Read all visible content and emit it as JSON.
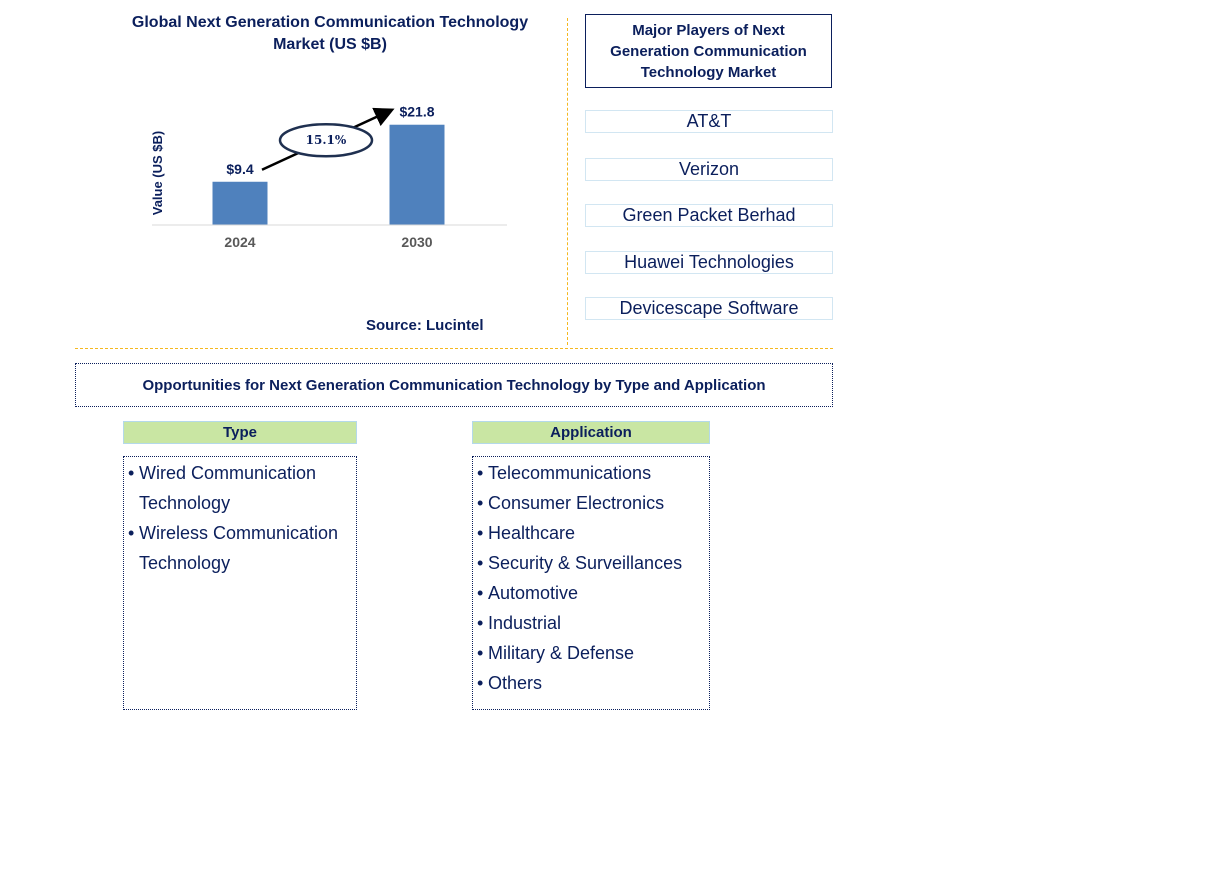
{
  "chart_data": {
    "type": "bar",
    "title": "Global Next Generation Communication Technology Market (US $B)",
    "categories": [
      "2024",
      "2030"
    ],
    "values": [
      9.4,
      21.8
    ],
    "value_labels": [
      "$9.4",
      "$21.8"
    ],
    "xlabel": "",
    "ylabel": "Value (US $B)",
    "ylim": [
      0,
      25
    ],
    "grid": false,
    "bar_color": "#4f81bd",
    "annotation": {
      "text": "15.1%",
      "kind": "CAGR arrow",
      "from": "2024",
      "to": "2030"
    },
    "source": "Source: Lucintel"
  },
  "players": {
    "title": "Major Players of Next Generation Communication Technology Market",
    "items": [
      "AT&T",
      "Verizon",
      "Green Packet Berhad",
      "Huawei Technologies",
      "Devicescape Software"
    ]
  },
  "opportunities": {
    "title": "Opportunities for Next Generation Communication Technology by Type and Application",
    "type": {
      "heading": "Type",
      "items": [
        "Wired Communication Technology",
        "Wireless Communication Technology"
      ]
    },
    "application": {
      "heading": "Application",
      "items": [
        "Telecommunications",
        "Consumer Electronics",
        "Healthcare",
        "Security & Surveillances",
        "Automotive",
        "Industrial",
        "Military & Defense",
        "Others"
      ]
    }
  },
  "colors": {
    "text": "#0b1f5c",
    "bar": "#4f81bd",
    "divider": "#f5b820",
    "header_fill": "#c9e6a3",
    "player_border": "#d2e6f2"
  }
}
